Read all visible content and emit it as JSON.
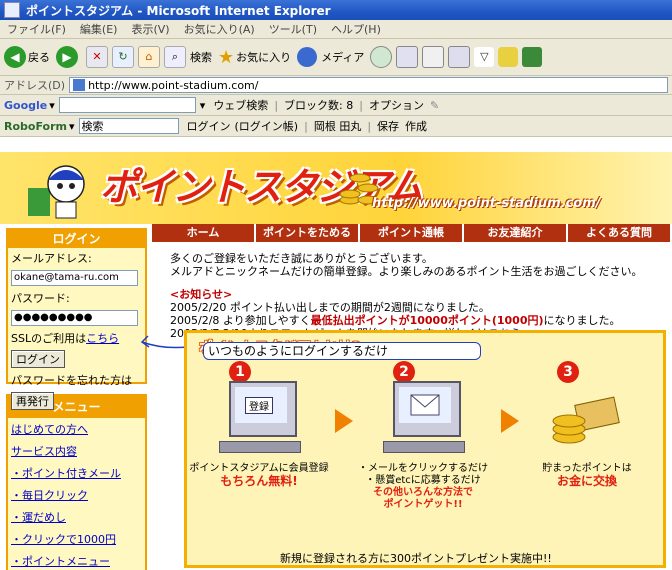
{
  "window": {
    "title": "ポイントスタジアム - Microsoft Internet Explorer"
  },
  "menubar": [
    "ファイル(F)",
    "編集(E)",
    "表示(V)",
    "お気に入り(A)",
    "ツール(T)",
    "ヘルプ(H)"
  ],
  "toolbar": {
    "back": "戻る",
    "search": "検索",
    "favorites": "お気に入り",
    "media": "メディア"
  },
  "address": {
    "label": "アドレス(D)",
    "url": "http://www.point-stadium.com/"
  },
  "google_bar": {
    "logo": "Google",
    "web_search": "ウェブ検索",
    "blocked": "ブロック数: 8",
    "options": "オプション"
  },
  "roboform_bar": {
    "logo": "RoboForm",
    "select": "検索",
    "login": "ログイン",
    "login_book": "(ログイン帳)",
    "user": "岡根 田丸",
    "save": "保存",
    "create": "作成"
  },
  "banner": {
    "logo_text": "ポイントスタジアム",
    "url": "http://www.point-stadium.com/"
  },
  "nav": [
    "ホーム",
    "ポイントをためる",
    "ポイント通帳",
    "お友達紹介",
    "よくある質問"
  ],
  "login": {
    "heading": "ログイン",
    "email_label": "メールアドレス:",
    "email_value": "okane@tama-ru.com",
    "password_label": "パスワード:",
    "password_value": "●●●●●●●●●",
    "ssl_text": "SSLのご利用は",
    "ssl_link": "こちら",
    "login_button": "ログイン",
    "forgot_text": "パスワードを忘れた方は",
    "reissue_button": "再発行"
  },
  "menu": {
    "heading": "メニュー",
    "items": [
      "はじめての方へ",
      "サービス内容",
      "・ポイント付きメール",
      "・毎日クリック",
      "・運だめし",
      "・クリックで1000円",
      "・ポイントメニュー"
    ]
  },
  "content": {
    "intro1": "多くのご登録をいただき誠にありがとうございます。",
    "intro2": "メルアドとニックネームだけの簡単登録。より楽しみのあるポイント生活をお過ごしください。",
    "notice_heading": "<お知らせ>",
    "news": [
      {
        "date": "2005/2/20",
        "text": "ポイント払い出しまでの期間が2週間になりました。"
      },
      {
        "date": "2005/2/8",
        "text_pre": "より参加しやすく",
        "text_red": "最低払出ポイントが10000ポイント(1000円)",
        "text_post": "になりました。"
      },
      {
        "date": "2005/2/7",
        "text": "2/10よりスロットゲームを開始いたします。詳しくは",
        "link": "こちら"
      }
    ],
    "callout": "いつものようにログインするだけ"
  },
  "whatis": {
    "title": "ポイントスタジアムとは?",
    "steps": [
      {
        "num": "1",
        "screen_label": "登録",
        "cap1": "ポイントスタジアムに会員登録",
        "cap2": "もちろん無料!"
      },
      {
        "num": "2",
        "cap1": "・メールをクリックするだけ",
        "cap2": "・懸賞etcに応募するだけ",
        "cap3": "その他いろんな方法で",
        "cap4": "ポイントゲット!!"
      },
      {
        "num": "3",
        "cap1": "貯まったポイントは",
        "cap2": "お金に交換"
      }
    ]
  },
  "footer": {
    "text": "新規に登録される方に300ポイントプレゼント実施中!!"
  },
  "colors": {
    "accent_red": "#c00000",
    "nav_bg": "#b03010",
    "box_border": "#f0a000",
    "box_bg": "#fff8c0"
  }
}
